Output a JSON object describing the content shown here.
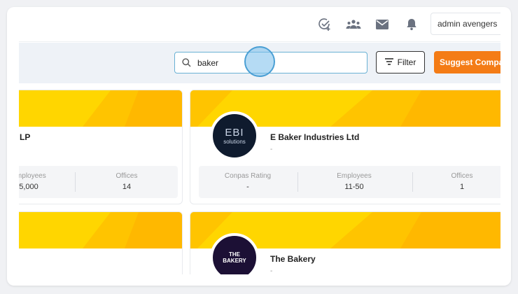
{
  "header": {
    "user_name": "admin avengers",
    "icons": [
      "add-task-icon",
      "team-icon",
      "mail-icon",
      "bell-icon"
    ]
  },
  "toolbar": {
    "search_value": "baker",
    "filter_label": "Filter",
    "suggest_label": "Suggest Company",
    "accent_color": "#f47c16"
  },
  "cards": [
    {
      "name": "LP",
      "sub": "",
      "stats": [
        {
          "label": "Employees",
          "value": "5,000"
        },
        {
          "label": "Offices",
          "value": "14"
        }
      ]
    },
    {
      "name": "E Baker Industries Ltd",
      "sub": "-",
      "logo_text_main": "EBI",
      "logo_text_sub": "solutions",
      "stats": [
        {
          "label": "Conpas Rating",
          "value": "-"
        },
        {
          "label": "Employees",
          "value": "11-50"
        },
        {
          "label": "Offices",
          "value": "1"
        }
      ]
    },
    {
      "name": "",
      "sub": ""
    },
    {
      "name": "The Bakery",
      "sub": "-",
      "logo_text_main": "THE",
      "logo_text_sub": "BAKERY"
    }
  ]
}
